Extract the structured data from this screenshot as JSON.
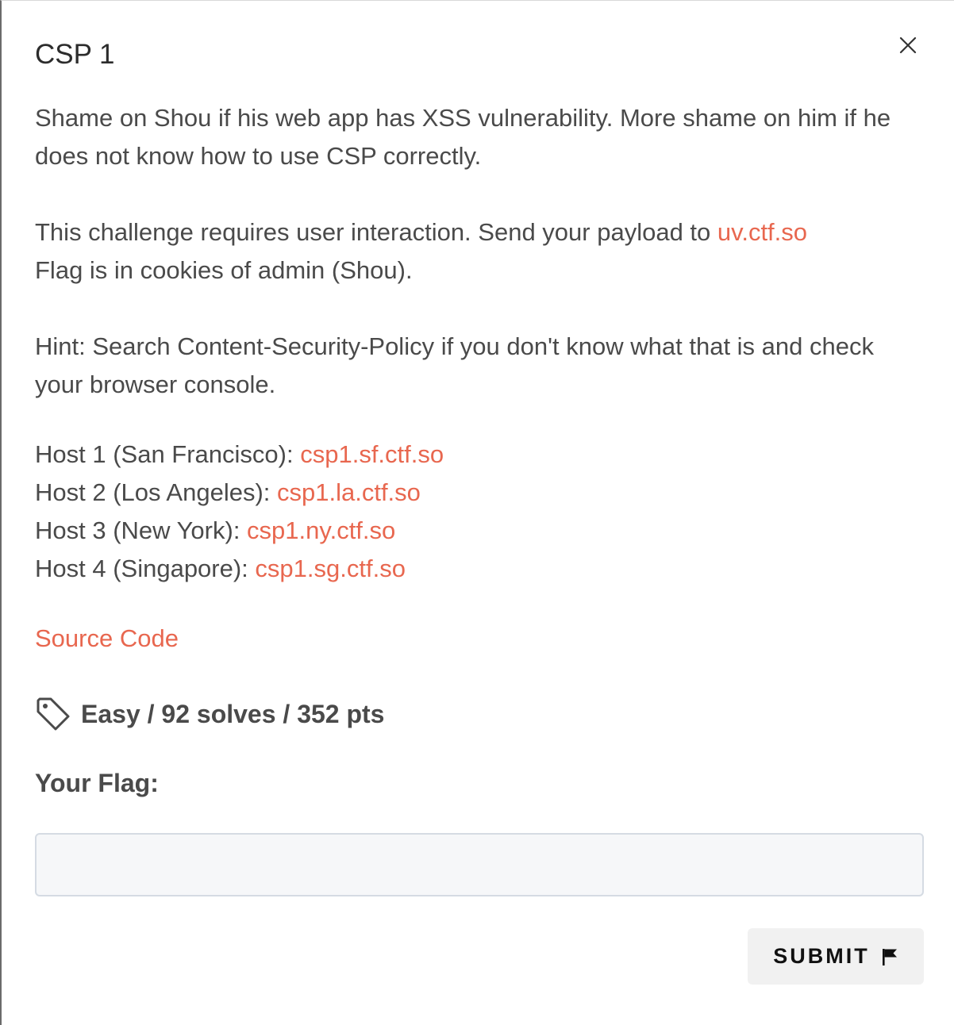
{
  "modal": {
    "title": "CSP 1",
    "close_icon": "close-icon"
  },
  "description": {
    "para1": "Shame on Shou if his web app has XSS vulnerability. More shame on him if he does not know how to use CSP correctly.",
    "para2_text": "This challenge requires user interaction. Send your payload to ",
    "para2_link": "uv.ctf.so",
    "para2_line2": "Flag is in cookies of admin (Shou).",
    "hint": "Hint: Search Content-Security-Policy if you don't know what that is and check your browser console.",
    "hosts": [
      {
        "label": "Host 1 (San Francisco): ",
        "link": "csp1.sf.ctf.so"
      },
      {
        "label": "Host 2 (Los Angeles): ",
        "link": "csp1.la.ctf.so"
      },
      {
        "label": "Host 3 (New York): ",
        "link": "csp1.ny.ctf.so"
      },
      {
        "label": "Host 4 (Singapore): ",
        "link": "csp1.sg.ctf.so"
      }
    ]
  },
  "source_link": "Source Code",
  "meta": {
    "tag_icon": "tag-icon",
    "text": "Easy / 92 solves / 352 pts"
  },
  "flag_form": {
    "label": "Your Flag:",
    "value": "",
    "placeholder": "",
    "submit_label": "SUBMIT",
    "submit_icon": "flag-icon"
  },
  "colors": {
    "link": "#e8674f",
    "text": "#4a4a4a",
    "input_bg": "#f6f7f9",
    "button_bg": "#f1f1f1"
  }
}
